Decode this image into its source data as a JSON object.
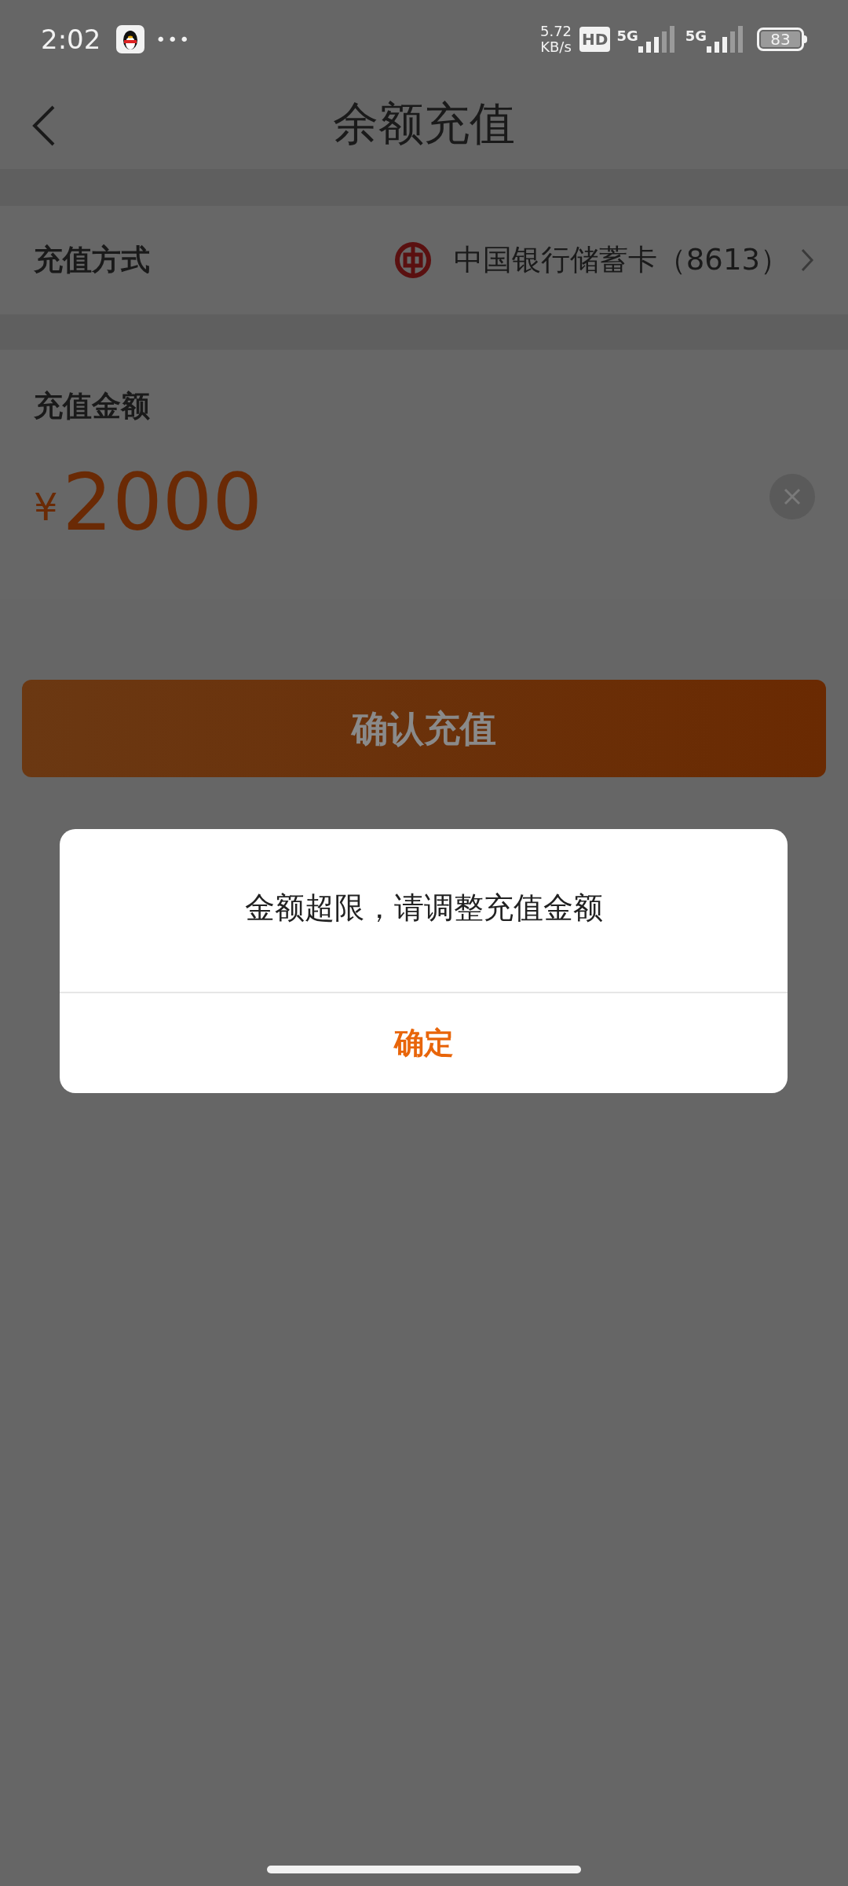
{
  "status_bar": {
    "time": "2:02",
    "more": "•••",
    "speed_value": "5.72",
    "speed_unit": "KB/s",
    "hd_label": "HD",
    "network_labels": [
      "5G",
      "5G"
    ],
    "battery": "83"
  },
  "header": {
    "title": "余额充值"
  },
  "payment_method": {
    "label": "充值方式",
    "bank": "中国银行储蓄卡（8613）"
  },
  "amount": {
    "label": "充值金额",
    "currency": "¥",
    "value": "2000"
  },
  "confirm_button": {
    "label": "确认充值"
  },
  "dialog": {
    "message": "金额超限，请调整充值金额",
    "button": "确定"
  }
}
